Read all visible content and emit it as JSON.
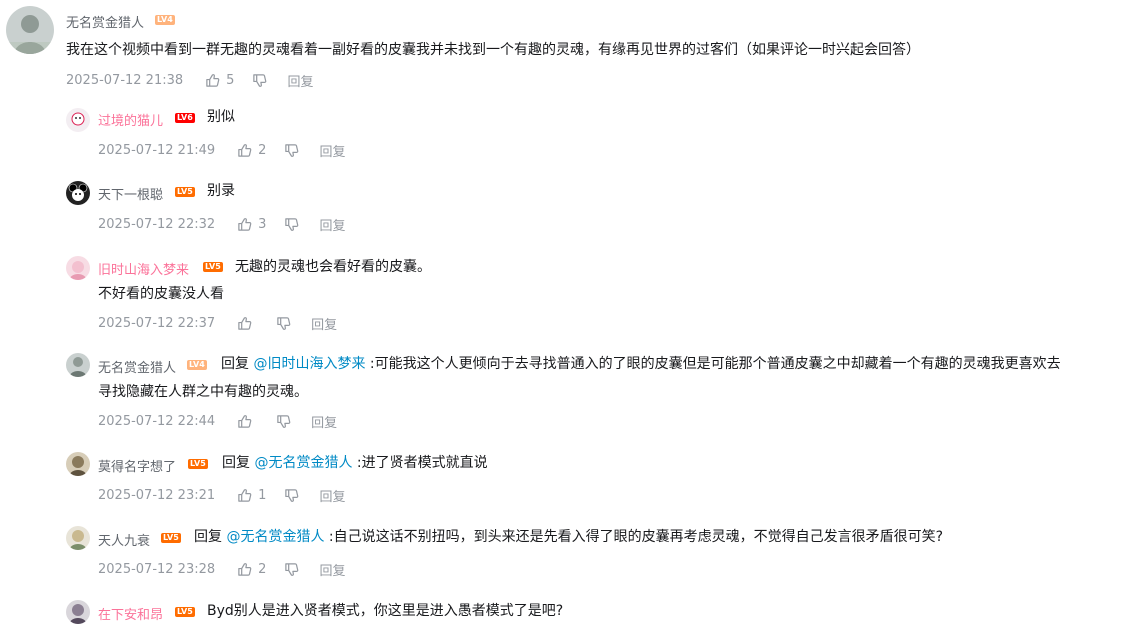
{
  "main_comment": {
    "username": "无名赏金猎人",
    "level": "LV4",
    "text": "我在这个视频中看到一群无趣的灵魂看着一副好看的皮囊我并未找到一个有趣的灵魂，有缘再见世界的过客们（如果评论一时兴起会回答）",
    "time": "2025-07-12 21:38",
    "likes": "5",
    "reply_label": "回复"
  },
  "replies": [
    {
      "username": "过境的猫儿",
      "level": "LV6",
      "name_color": "pink",
      "text": "别似",
      "time": "2025-07-12 21:49",
      "likes": "2",
      "reply_label": "回复"
    },
    {
      "username": "天下一根聪",
      "level": "LV5",
      "name_color": "normal",
      "text": "别录",
      "time": "2025-07-12 22:32",
      "likes": "3",
      "reply_label": "回复"
    },
    {
      "username": "旧时山海入梦来",
      "level": "LV5",
      "name_color": "pink",
      "text_line1": "无趣的灵魂也会看好看的皮囊。",
      "text_line2": "不好看的皮囊没人看",
      "time": "2025-07-12 22:37",
      "likes": "",
      "reply_label": "回复"
    },
    {
      "username": "无名赏金猎人",
      "level": "LV4",
      "name_color": "normal",
      "prefix": "回复",
      "mention": "@旧时山海入梦来",
      "text_line1": " :可能我这个人更倾向于去寻找普通入的了眼的皮囊但是可能那个普通皮囊之中却藏着一个有趣的灵魂我更喜欢去",
      "text_line2": "寻找隐藏在人群之中有趣的灵魂。",
      "time": "2025-07-12 22:44",
      "likes": "",
      "reply_label": "回复"
    },
    {
      "username": "莫得名字想了",
      "level": "LV5",
      "name_color": "normal",
      "prefix": "回复",
      "mention": "@无名赏金猎人",
      "text": " :进了贤者模式就直说",
      "time": "2025-07-12 23:21",
      "likes": "1",
      "reply_label": "回复"
    },
    {
      "username": "天人九衰",
      "level": "LV5",
      "name_color": "normal",
      "prefix": "回复",
      "mention": "@无名赏金猎人",
      "text": " :自己说这话不别扭吗，到头来还是先看入得了眼的皮囊再考虑灵魂，不觉得自己发言很矛盾很可笑?",
      "time": "2025-07-12 23:28",
      "likes": "2",
      "reply_label": "回复"
    },
    {
      "username": "在下安和昂",
      "level": "LV5",
      "name_color": "pink",
      "text": "Byd别人是进入贤者模式，你这里是进入愚者模式了是吧?"
    }
  ],
  "colors": {
    "pink_name": "#fb7299",
    "mention": "#008ac5",
    "meta": "#9499a0",
    "text": "#18191c"
  }
}
